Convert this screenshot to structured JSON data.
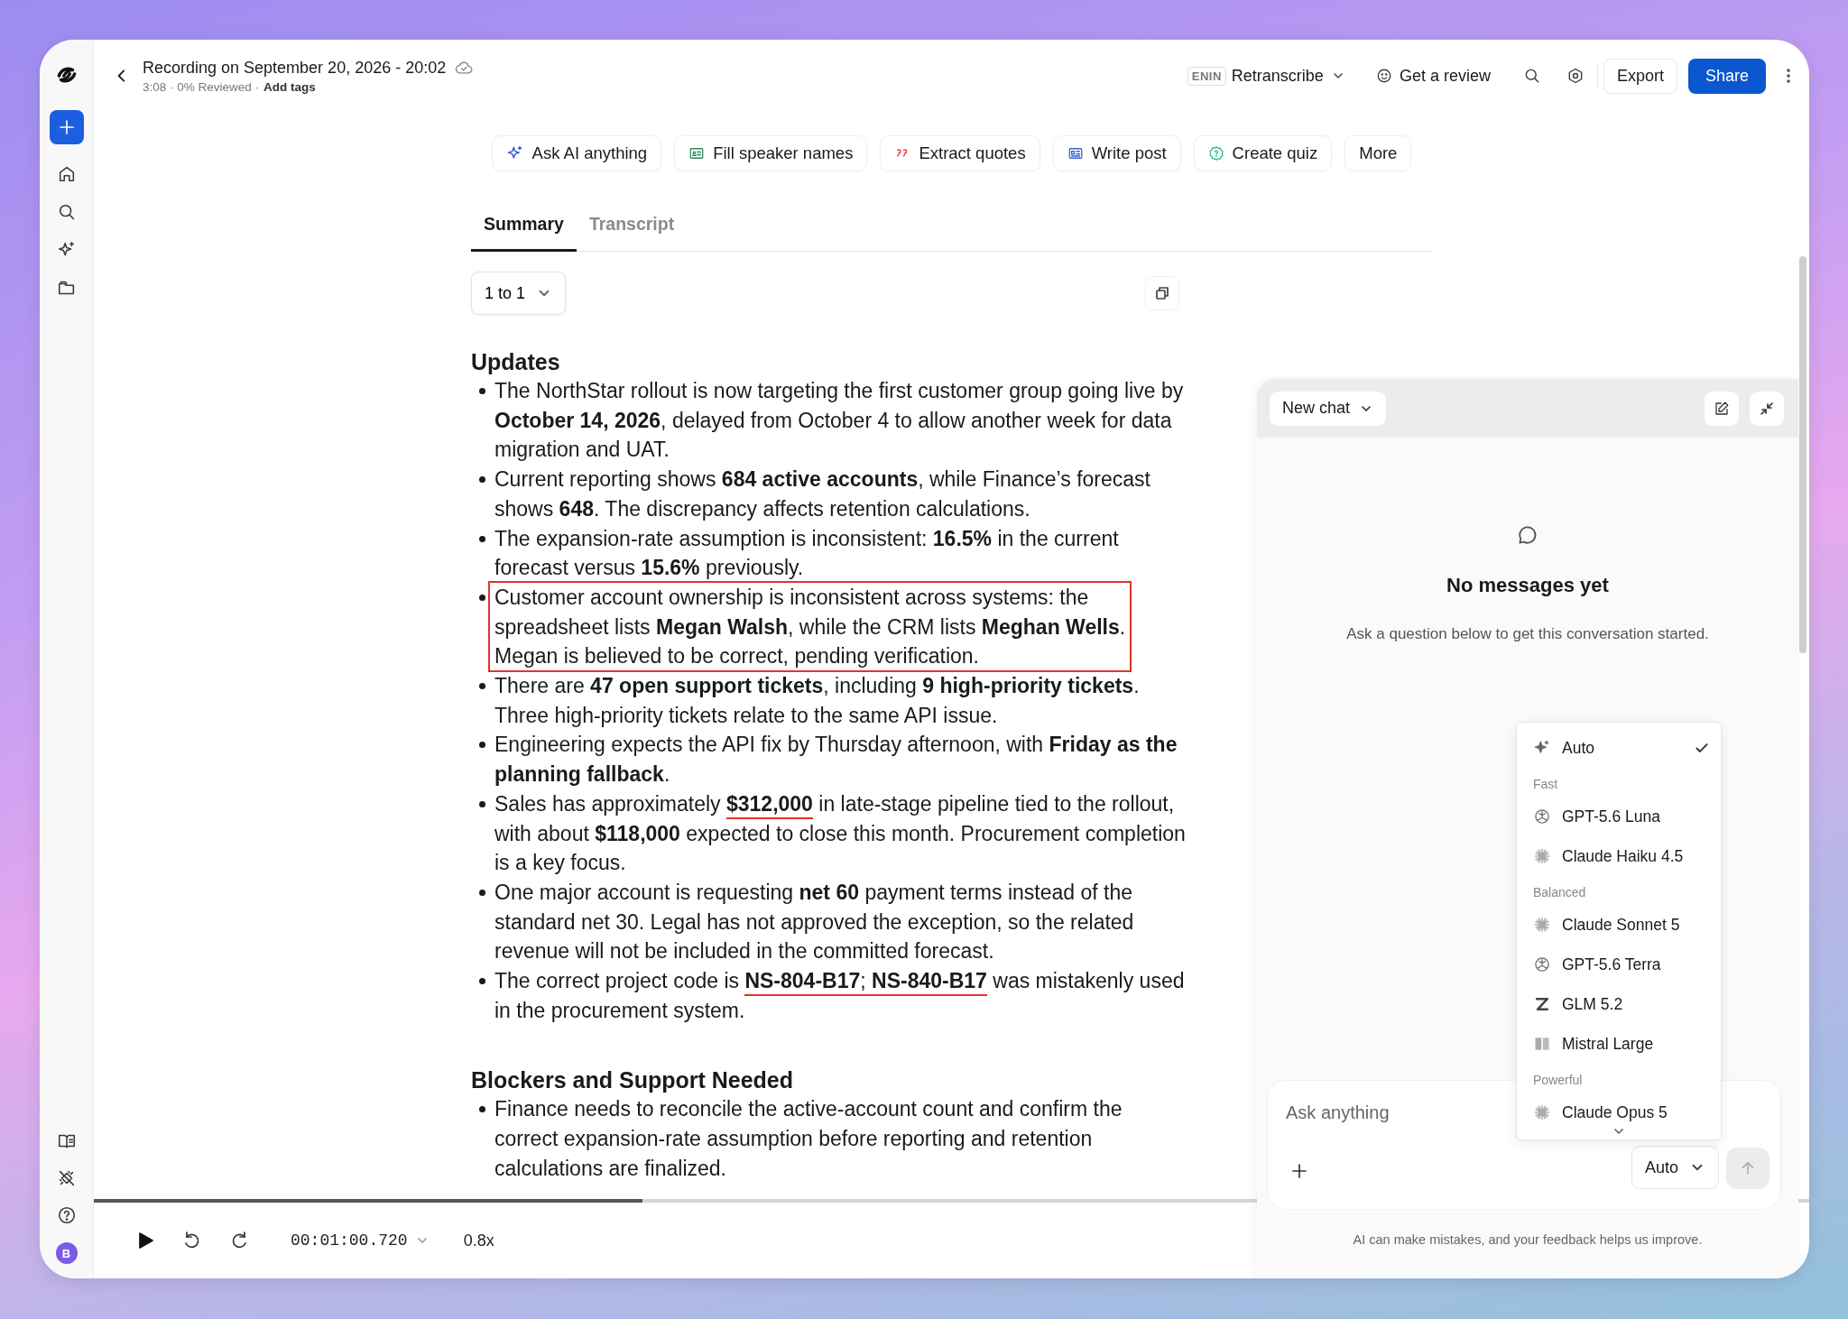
{
  "sidebar": {
    "avatar": "B"
  },
  "header": {
    "title": "Recording on September 20, 2026 - 20:02",
    "meta": "3:08 · 0% Reviewed ·",
    "add_tags": "Add tags",
    "language": "ENIN",
    "retranscribe": "Retranscribe",
    "review": "Get a review",
    "export": "Export",
    "share": "Share"
  },
  "actions": [
    {
      "label": "Ask AI anything",
      "kind": "sparkle"
    },
    {
      "label": "Fill speaker names",
      "kind": "card"
    },
    {
      "label": "Extract quotes",
      "kind": "quote"
    },
    {
      "label": "Write post",
      "kind": "post"
    },
    {
      "label": "Create quiz",
      "kind": "quiz"
    },
    {
      "label": "More",
      "kind": "plain"
    }
  ],
  "tabs": [
    {
      "label": "Summary",
      "selected": true
    },
    {
      "label": "Transcript",
      "selected": false
    }
  ],
  "template_select": {
    "value": "1 to 1"
  },
  "sections": [
    {
      "heading": "Updates",
      "bullets": [
        {
          "boxed": false,
          "parts": [
            {
              "text": "The NorthStar rollout is now targeting the first customer group going live by **October 14, 2026**, delayed from October 4 to allow another week for data migration and UAT.",
              "underlined": false
            }
          ]
        },
        {
          "boxed": false,
          "parts": [
            {
              "text": "Current reporting shows **684 active accounts**, while Finance’s forecast shows **648**. The discrepancy affects retention calculations.",
              "underlined": false
            }
          ]
        },
        {
          "boxed": false,
          "parts": [
            {
              "text": "The expansion-rate assumption is inconsistent: **16.5%** in the current forecast versus **15.6%** previously.",
              "underlined": false
            }
          ]
        },
        {
          "boxed": true,
          "parts": [
            {
              "text": "Customer account ownership is inconsistent across systems: the spreadsheet lists **Megan Walsh**, while the CRM lists **Meghan Wells**. Megan is believed to be correct, pending verification.",
              "underlined": false
            }
          ]
        },
        {
          "boxed": false,
          "parts": [
            {
              "text": "There are **47 open support tickets**, including **9 high-priority tickets**. Three high-priority tickets relate to the same API issue.",
              "underlined": false
            }
          ]
        },
        {
          "boxed": false,
          "parts": [
            {
              "text": "Engineering expects the API fix by Thursday afternoon, with **Friday as the planning fallback**.",
              "underlined": false
            }
          ]
        },
        {
          "boxed": false,
          "parts": [
            {
              "text": "Sales has approximately ",
              "underlined": false
            },
            {
              "text": "**$312,000**",
              "underlined": true
            },
            {
              "text": " in late-stage pipeline tied to the rollout, with about **$118,000** expected to close this month. Procurement completion is a key focus.",
              "underlined": false
            }
          ]
        },
        {
          "boxed": false,
          "parts": [
            {
              "text": "One major account is requesting **net 60** payment terms instead of the standard net 30. Legal has not approved the exception, so the related revenue will not be included in the committed forecast.",
              "underlined": false
            }
          ]
        },
        {
          "boxed": false,
          "parts": [
            {
              "text": "The correct project code is ",
              "underlined": false
            },
            {
              "text": "**NS-804-B17**; **NS-840-B17**",
              "underlined": true
            },
            {
              "text": " was mistakenly used in the procurement system.",
              "underlined": false
            }
          ]
        }
      ]
    },
    {
      "heading": "Blockers and Support Needed",
      "bullets": [
        {
          "boxed": false,
          "parts": [
            {
              "text": "Finance needs to reconcile the active-account count and confirm the correct expansion-rate assumption before reporting and retention calculations are finalized.",
              "underlined": false
            }
          ]
        }
      ]
    }
  ],
  "player": {
    "level": 0.32,
    "time": "00:01:00.720",
    "speed": "0.8x"
  },
  "chat": {
    "title": "New chat",
    "empty_title": "No messages yet",
    "empty_text": "Ask a question below to get this conversation started.",
    "input": {
      "placeholder": "Ask anything"
    },
    "model": "Auto",
    "send": {
      "disabled": true
    },
    "disclaimer": "AI can make mistakes, and your feedback helps us improve.",
    "model_menu": {
      "options": [
        {
          "label": "Auto",
          "kind": "sparkle",
          "selected": true
        }
      ],
      "groups": [
        {
          "label": "Fast",
          "options": [
            {
              "label": "GPT-5.6 Luna",
              "kind": "knot",
              "selected": false
            },
            {
              "label": "Claude Haiku 4.5",
              "kind": "burst",
              "selected": false
            }
          ]
        },
        {
          "label": "Balanced",
          "options": [
            {
              "label": "Claude Sonnet 5",
              "kind": "burst",
              "selected": false
            },
            {
              "label": "GPT-5.6 Terra",
              "kind": "knot",
              "selected": false
            },
            {
              "label": "GLM 5.2",
              "kind": "zee",
              "selected": false
            },
            {
              "label": "Mistral Large",
              "kind": "bars",
              "selected": false
            }
          ]
        },
        {
          "label": "Powerful",
          "options": [
            {
              "label": "Claude Opus 5",
              "kind": "burst",
              "selected": false
            }
          ]
        }
      ]
    }
  }
}
